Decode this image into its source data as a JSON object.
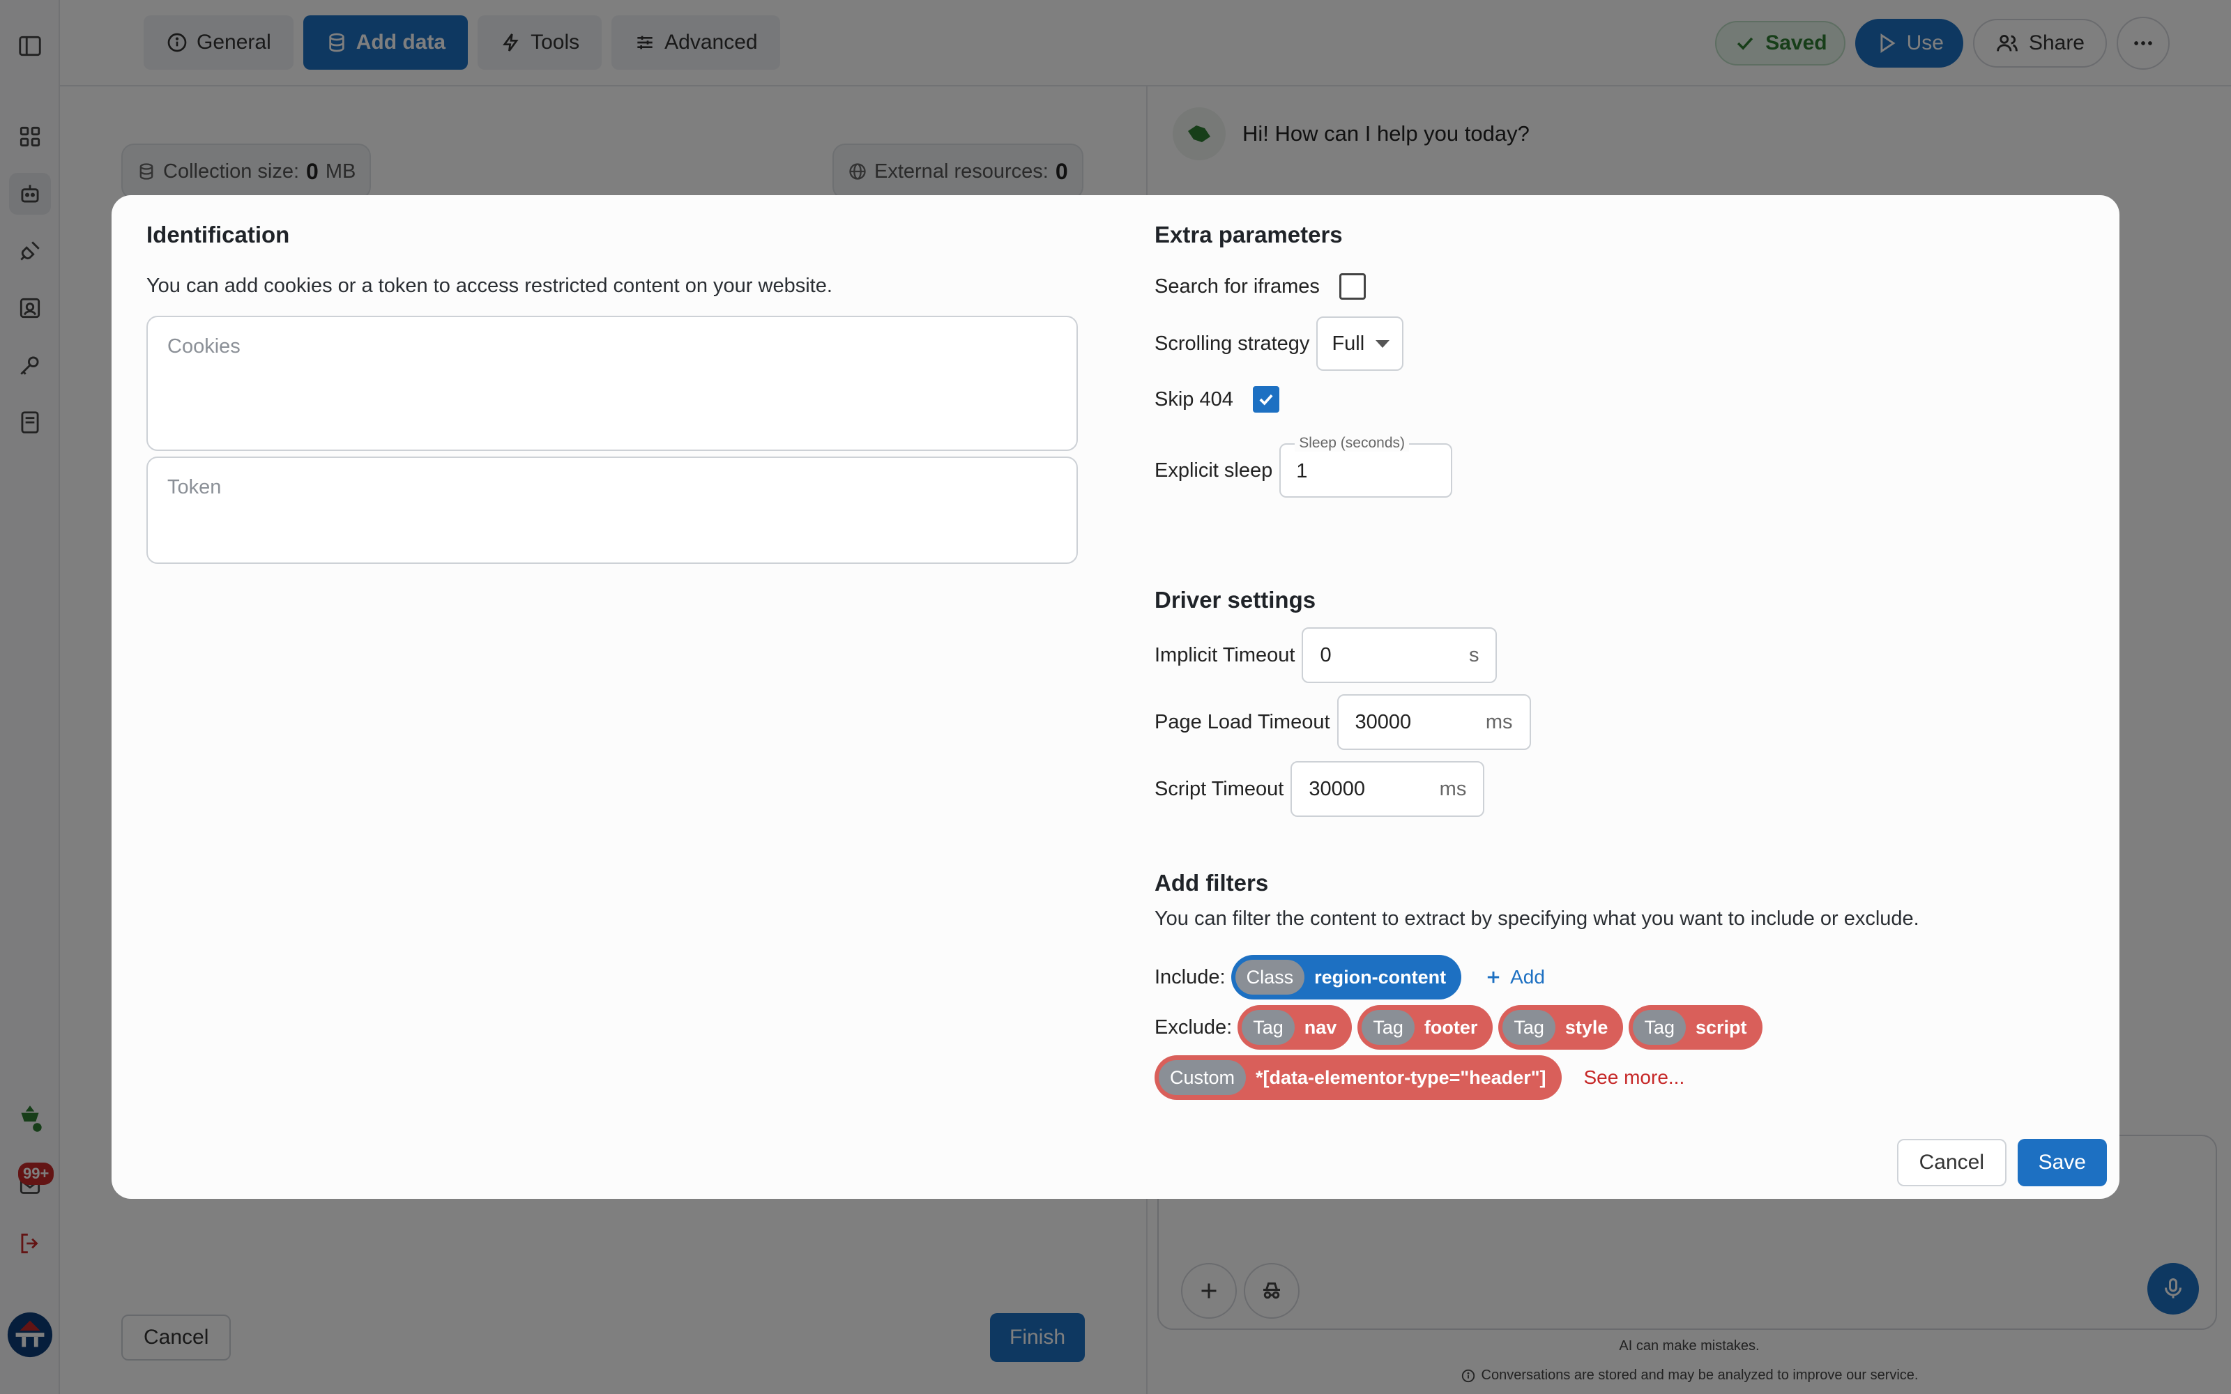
{
  "topbar": {
    "tabs": [
      {
        "label": "General",
        "icon": "info-icon"
      },
      {
        "label": "Add data",
        "icon": "database-icon",
        "active": true
      },
      {
        "label": "Tools",
        "icon": "bolt-icon"
      },
      {
        "label": "Advanced",
        "icon": "sliders-icon"
      }
    ],
    "saved_label": "Saved",
    "use_label": "Use",
    "share_label": "Share"
  },
  "sidebar": {
    "badge": "99+"
  },
  "left_panel": {
    "collection_size_label": "Collection size:",
    "collection_size_value": "0",
    "collection_size_unit": "MB",
    "external_resources_label": "External resources:",
    "external_resources_value": "0",
    "cancel_label": "Cancel",
    "finish_label": "Finish"
  },
  "chat": {
    "greeting": "Hi! How can I help you today?",
    "disclaimer": "AI can make mistakes.",
    "privacy_note": "Conversations are stored and may be analyzed to improve our service."
  },
  "modal": {
    "identification": {
      "title": "Identification",
      "description": "You can add cookies or a token to access restricted content on your website.",
      "cookies_placeholder": "Cookies",
      "token_placeholder": "Token"
    },
    "extra": {
      "title": "Extra parameters",
      "iframes_label": "Search for iframes",
      "iframes_checked": false,
      "scrolling_label": "Scrolling strategy",
      "scrolling_value": "Full",
      "skip404_label": "Skip 404",
      "skip404_checked": true,
      "sleep_label": "Explicit sleep",
      "sleep_legend": "Sleep (seconds)",
      "sleep_value": "1"
    },
    "driver": {
      "title": "Driver settings",
      "implicit_label": "Implicit Timeout",
      "implicit_value": "0",
      "implicit_unit": "s",
      "pageload_label": "Page Load Timeout",
      "pageload_value": "30000",
      "pageload_unit": "ms",
      "script_label": "Script Timeout",
      "script_value": "30000",
      "script_unit": "ms"
    },
    "filters": {
      "title": "Add filters",
      "description": "You can filter the content to extract by specifying what you want to include or exclude.",
      "include_label": "Include:",
      "include": [
        {
          "type": "Class",
          "value": "region-content"
        }
      ],
      "add_label": "Add",
      "exclude_label": "Exclude:",
      "exclude": [
        {
          "type": "Tag",
          "value": "nav"
        },
        {
          "type": "Tag",
          "value": "footer"
        },
        {
          "type": "Tag",
          "value": "style"
        },
        {
          "type": "Tag",
          "value": "script"
        }
      ],
      "exclude_custom": {
        "type": "Custom",
        "value": "*[data-elementor-type=\"header\"]"
      },
      "see_more_label": "See more..."
    },
    "cancel_label": "Cancel",
    "save_label": "Save"
  },
  "colors": {
    "primary": "#1d70c2",
    "exclude_chip": "#d95f5a",
    "saved_green": "#2e7d32"
  }
}
